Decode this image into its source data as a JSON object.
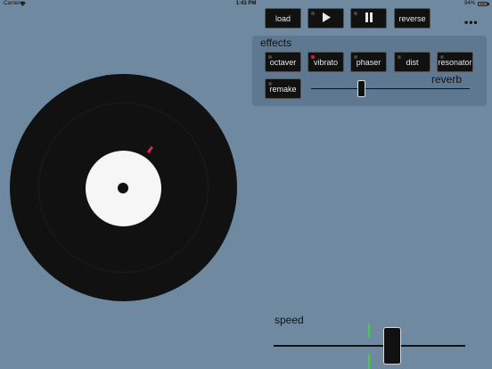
{
  "status_bar": {
    "carrier": "Carrier",
    "wifi_icon": "wifi-icon",
    "time": "1:43 PM",
    "battery": "94%",
    "battery_icon": "battery-icon"
  },
  "transport": {
    "load_label": "load",
    "play_icon": "play-icon",
    "pause_icon": "pause-icon",
    "reverse_label": "reverse",
    "more_icon": "more-icon",
    "more_glyph": "•••"
  },
  "effects": {
    "title": "effects",
    "items": [
      {
        "label": "octaver",
        "active": false
      },
      {
        "label": "vibrato",
        "active": true
      },
      {
        "label": "phaser",
        "active": false
      },
      {
        "label": "dist",
        "active": false
      },
      {
        "label": "resonator",
        "active": false
      }
    ],
    "remake_label": "remake",
    "reverb_label": "reverb",
    "reverb_value": 0.32,
    "led_active_color": "#d21f3c",
    "led_inactive_color": "#444444"
  },
  "turntable": {
    "marker_color": "#cc2b55"
  },
  "speed": {
    "label": "speed",
    "value": 0.62,
    "tick_color": "#3bd63b"
  },
  "colors": {
    "background": "#6f8aa0",
    "panel": "#5f7891",
    "button": "#111111"
  }
}
